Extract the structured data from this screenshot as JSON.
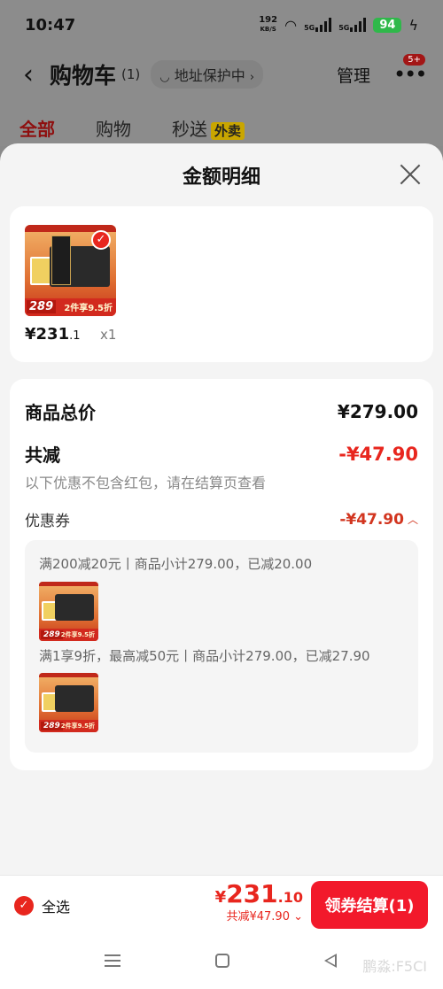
{
  "status_bar": {
    "time": "10:47",
    "net_speed_value": "192",
    "net_speed_unit": "KB/S",
    "signal1_label": "5G",
    "signal2_label": "5G",
    "battery": "94"
  },
  "header": {
    "title": "购物车",
    "count": "(1)",
    "address_label": "地址保护中",
    "manage_label": "管理",
    "more_badge": "5+"
  },
  "tabs": [
    {
      "label": "全部"
    },
    {
      "label": "购物"
    },
    {
      "label": "秒送"
    }
  ],
  "takeout_badge": "外卖",
  "sheet": {
    "title": "金额明细",
    "product": {
      "thumb_price": "289",
      "thumb_promo": "2件享9.5折",
      "price_int": "¥231",
      "price_dec": ".1",
      "qty": "x1"
    },
    "summary": {
      "total_label": "商品总价",
      "total_value": "¥279.00",
      "discount_label": "共减",
      "discount_value": "-¥47.90",
      "discount_note": "以下优惠不包含红包，请在结算页查看",
      "coupon_label": "优惠券",
      "coupon_value": "-¥47.90",
      "details": [
        {
          "text": "满200减20元丨商品小计279.00，已减20.00"
        },
        {
          "text": "满1享9折，最高减50元丨商品小计279.00，已减27.90"
        }
      ],
      "mini_thumb_price": "289",
      "mini_thumb_promo": "2件享9.5折"
    }
  },
  "bottom_bar": {
    "select_all_label": "全选",
    "total_yen": "¥",
    "total_int": "231",
    "total_dec": ".10",
    "total_discount": "共减¥47.90 ⌄",
    "checkout_label": "领券结算(1)"
  },
  "nav": {
    "watermark": "鹏淼:F5CI"
  },
  "colors": {
    "accent_red": "#e8261e",
    "checkout_red": "#f2192b",
    "battery_green": "#2fb84a"
  }
}
